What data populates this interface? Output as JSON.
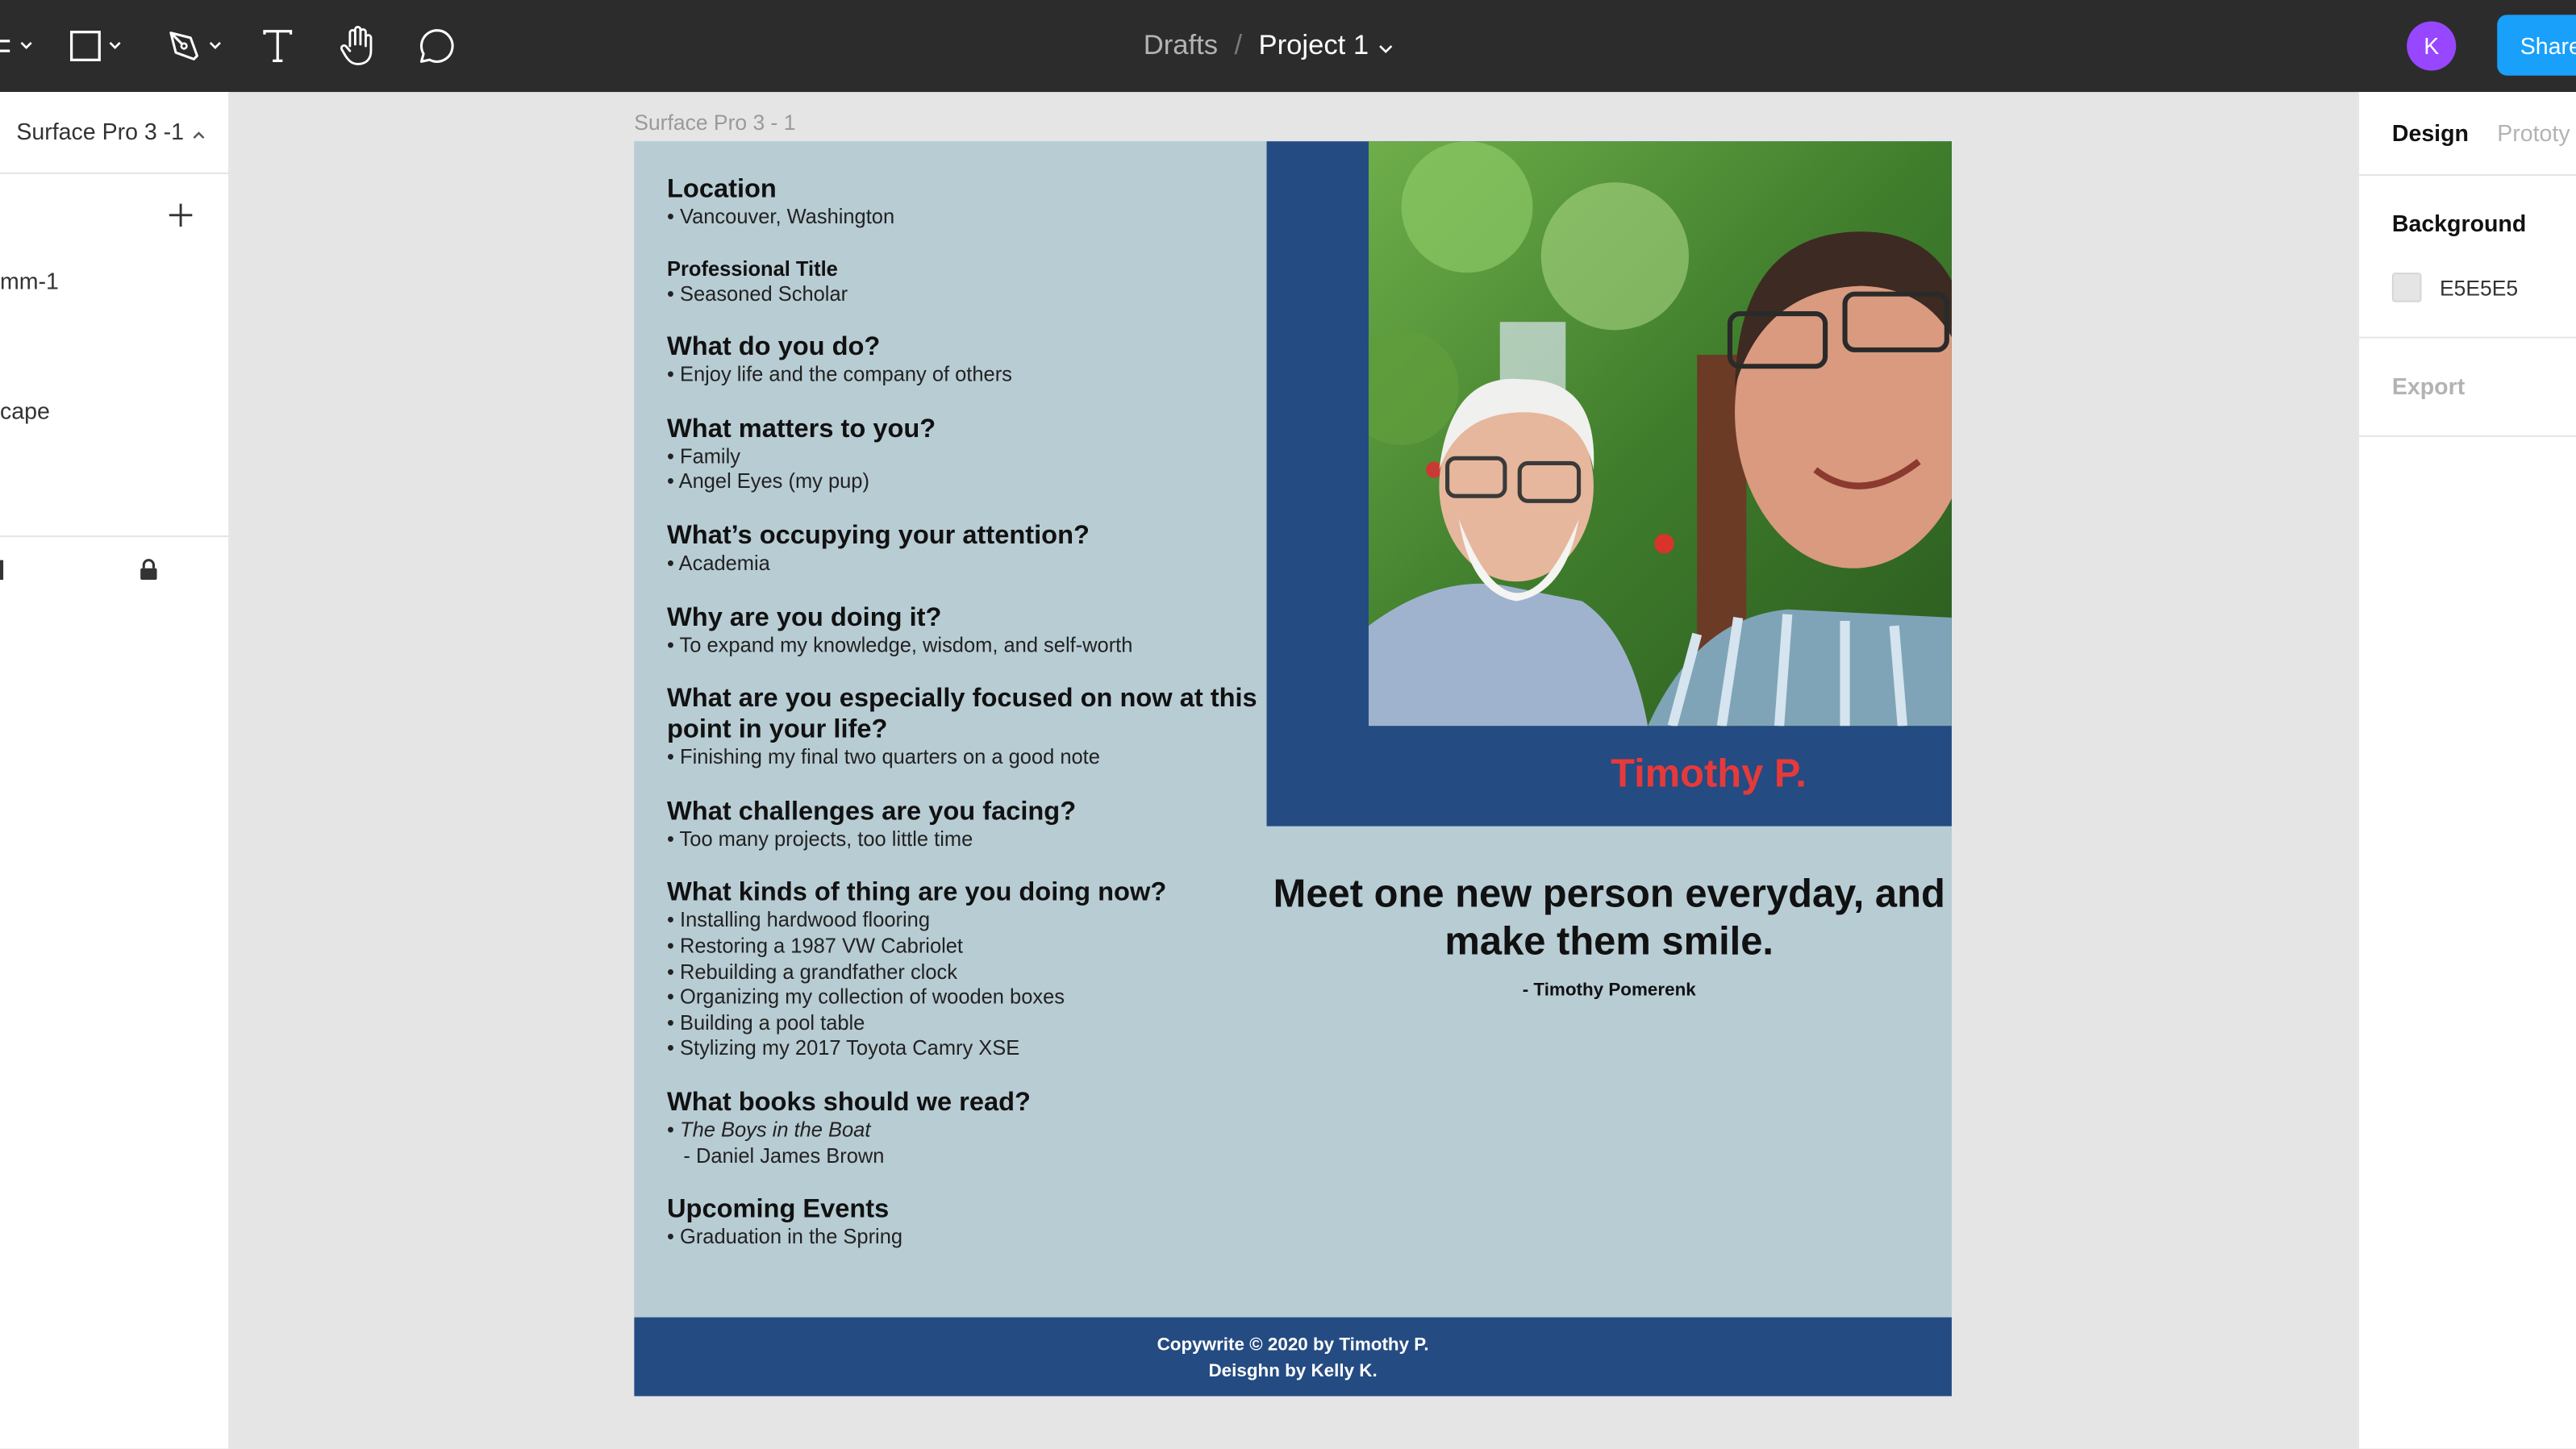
{
  "toolbar": {
    "breadcrumb_drafts": "Drafts",
    "breadcrumb_separator": "/",
    "project_name": "Project 1",
    "avatar_initial": "K",
    "share_label": "Share",
    "icons": [
      "frame-icon",
      "rectangle-icon",
      "pen-icon",
      "text-icon",
      "hand-icon",
      "comment-icon"
    ]
  },
  "left_panel": {
    "page_name": "Surface Pro 3 -1",
    "layers": [
      "mm-1",
      "cape"
    ]
  },
  "right_panel": {
    "tab_design": "Design",
    "tab_prototype": "Prototy",
    "background_label": "Background",
    "background_hex": "E5E5E5",
    "export_label": "Export"
  },
  "canvas": {
    "frame_label": "Surface Pro 3 - 1",
    "qa": [
      {
        "q": "Location",
        "a": [
          "• Vancouver, Washington"
        ]
      },
      {
        "q": "Professional Title",
        "a": [
          "• Seasoned Scholar"
        ]
      },
      {
        "q": "What do you do?",
        "a": [
          "• Enjoy life and the company of others"
        ]
      },
      {
        "q": "What matters to you?",
        "a": [
          "• Family",
          "• Angel Eyes (my pup)"
        ]
      },
      {
        "q": "What’s occupying your attention?",
        "a": [
          "• Academia"
        ]
      },
      {
        "q": "Why are you doing it?",
        "a": [
          "• To expand my knowledge, wisdom, and self-worth"
        ]
      },
      {
        "q": "What are you especially focused on now at this point in your life?",
        "a": [
          "• Finishing my final two quarters on a good note"
        ]
      },
      {
        "q": "What challenges are you facing?",
        "a": [
          "• Too many projects, too little time"
        ]
      },
      {
        "q": "What kinds of thing are you doing now?",
        "a": [
          "• Installing hardwood flooring",
          "• Restoring a 1987 VW Cabriolet",
          "• Rebuilding a grandfather clock",
          "• Organizing my collection of wooden boxes",
          "• Building a pool table",
          "• Stylizing my 2017 Toyota Camry XSE"
        ]
      },
      {
        "q": "What books should we read?",
        "a": [
          "• ",
          "The Boys in the Boat",
          "- Daniel James Brown"
        ]
      },
      {
        "q": "Upcoming Events",
        "a": [
          "• Graduation in the Spring"
        ]
      }
    ],
    "profile_name": "Timothy P.",
    "quote": "Meet one new person everyday, and make them smile.",
    "quote_author": "- Timothy Pomerenk",
    "footer_line1": "Copywrite © 2020 by Timothy P.",
    "footer_line2": "Deisghn by Kelly K.",
    "colors": {
      "frame_bg": "#b8ccd4",
      "navy": "#244b82",
      "name_red": "#e63a3a",
      "canvas_bg": "#e5e5e5",
      "share_blue": "#18a0fb",
      "avatar_purple": "#9747ff"
    }
  }
}
